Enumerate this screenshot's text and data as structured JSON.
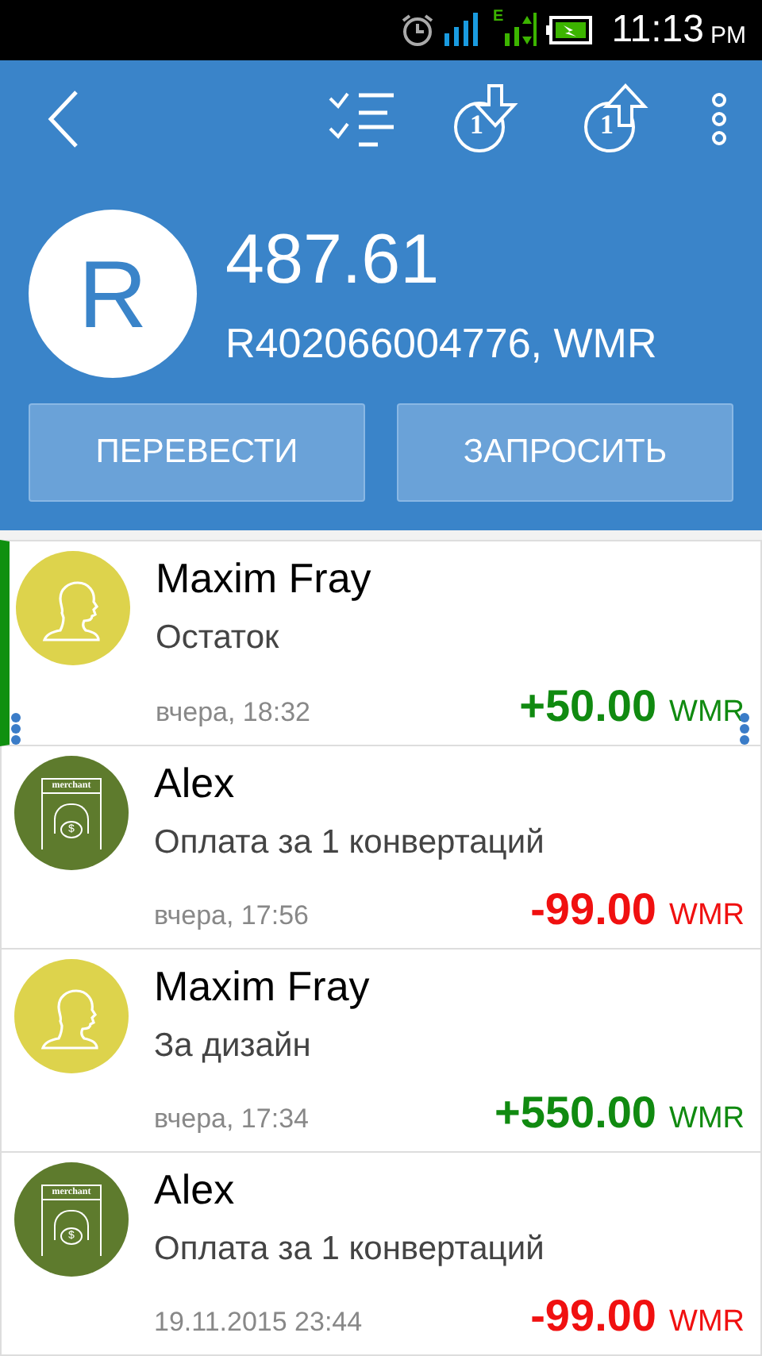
{
  "status_bar": {
    "network": "E",
    "time": "11:13",
    "ampm": "PM"
  },
  "toolbar": [
    {
      "kind": "back"
    },
    {
      "kind": "checklist"
    },
    {
      "kind": "incoming",
      "badge": "1"
    },
    {
      "kind": "outgoing",
      "badge": "1"
    },
    {
      "kind": "more"
    }
  ],
  "account": {
    "avatar_letter": "R",
    "balance": "487.61",
    "purse": "R402066004776, WMR"
  },
  "buttons": [
    "ПЕРЕВЕСТИ",
    "ЗАПРОСИТЬ"
  ],
  "transactions": [
    {
      "avatar": {
        "kind": "person"
      },
      "name": "Maxim Fray",
      "description": "Остаток",
      "date": "вчера, 18:32",
      "amount": "+50.00",
      "currency": "WMR",
      "kind": "income",
      "selected": true
    },
    {
      "avatar": {
        "kind": "merchant",
        "label": "merchant",
        "sign": "$"
      },
      "name": "Alex",
      "description": "Оплата за 1 конвертаций",
      "date": "вчера, 17:56",
      "amount": "-99.00",
      "currency": "WMR",
      "kind": "payment",
      "selected": false
    },
    {
      "avatar": {
        "kind": "person"
      },
      "name": "Maxim Fray",
      "description": "За дизайн",
      "date": "вчера, 17:34",
      "amount": "+550.00",
      "currency": "WMR",
      "kind": "income",
      "selected": false
    },
    {
      "avatar": {
        "kind": "merchant",
        "label": "merchant",
        "sign": "$"
      },
      "name": "Alex",
      "description": "Оплата за 1 конвертаций",
      "date": "19.11.2015 23:44",
      "amount": "-99.00",
      "currency": "WMR",
      "kind": "payment",
      "selected": false
    }
  ]
}
